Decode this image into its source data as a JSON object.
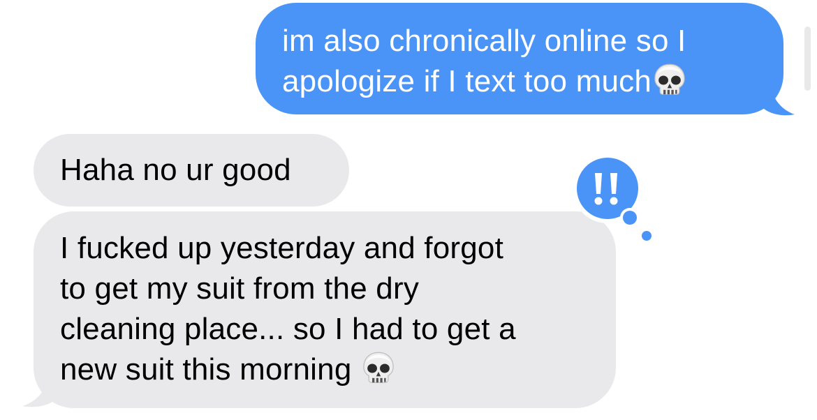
{
  "conversation": {
    "messages": [
      {
        "direction": "outgoing",
        "text": "im also chronically online so I\napologize if I text too much",
        "emoji": "skull-emoji"
      },
      {
        "direction": "incoming",
        "text": "Haha no ur good",
        "emoji": null
      },
      {
        "direction": "incoming",
        "text": "I fucked up yesterday and forgot\nto get my suit from the dry\ncleaning place... so I had to get a\nnew suit this morning",
        "emoji": "skull-emoji"
      }
    ],
    "tapback": {
      "icon": "double-exclamation-icon",
      "target_message": 2
    }
  },
  "colors": {
    "outgoing_bubble": "#4b94f7",
    "incoming_bubble": "#e9e9eb",
    "outgoing_text": "#ffffff",
    "incoming_text": "#000000",
    "tapback_bubble": "#4b94f7",
    "tapback_glyph": "#ffffff"
  }
}
